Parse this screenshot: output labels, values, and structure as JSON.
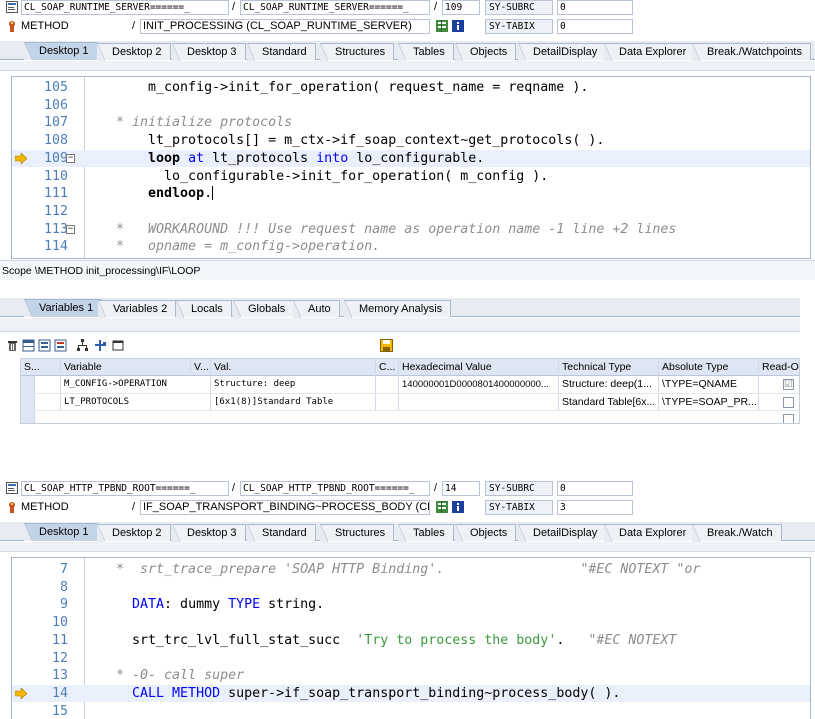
{
  "colors": {
    "tab_active": "#c4d4e8",
    "line_number": "#4f7eb7",
    "keyword": "#0000ff",
    "comment": "#8d8d8d",
    "string": "#3c9a3c",
    "arrow": "#f5b800"
  },
  "panel1": {
    "program": "CL_SOAP_RUNTIME_SERVER======_",
    "include": "CL_SOAP_RUNTIME_SERVER======_",
    "line": "109",
    "sy_subrc_label": "SY-SUBRC",
    "sy_subrc_value": "0",
    "event_type": "METHOD",
    "event_name": "INIT_PROCESSING (CL_SOAP_RUNTIME_SERVER)",
    "sy_tabix_label": "SY-TABIX",
    "sy_tabix_value": "0",
    "tabs": [
      "Desktop 1",
      "Desktop 2",
      "Desktop 3",
      "Standard",
      "Structures",
      "Tables",
      "Objects",
      "DetailDisplay",
      "Data Explorer",
      "Break./Watchpoints"
    ],
    "code": [
      {
        "ln": "105",
        "parts": [
          {
            "c": "",
            "t": "      m_config->init_for_operation( request_name = reqname )."
          }
        ]
      },
      {
        "ln": "106",
        "parts": []
      },
      {
        "ln": "107",
        "parts": [
          {
            "c": "cm",
            "t": "  * initialize protocols"
          }
        ]
      },
      {
        "ln": "108",
        "parts": [
          {
            "c": "",
            "t": "      lt_protocols[] = m_ctx->if_soap_context~get_protocols( )."
          }
        ]
      },
      {
        "ln": "109",
        "parts": [
          {
            "c": "kwb",
            "t": "      loop "
          },
          {
            "c": "kw",
            "t": "at "
          },
          {
            "c": "",
            "t": "lt_protocols "
          },
          {
            "c": "kw",
            "t": "into "
          },
          {
            "c": "",
            "t": "lo_configurable."
          }
        ]
      },
      {
        "ln": "110",
        "parts": [
          {
            "c": "",
            "t": "        lo_configurable->init_for_operation( m_config )."
          }
        ]
      },
      {
        "ln": "111",
        "parts": [
          {
            "c": "kwb",
            "t": "      endloop"
          },
          {
            "c": "",
            "t": "."
          }
        ]
      },
      {
        "ln": "112",
        "parts": []
      },
      {
        "ln": "113",
        "parts": [
          {
            "c": "cm",
            "t": "  *   WORKAROUND !!! Use request name as operation name -1 line +2 lines"
          }
        ]
      },
      {
        "ln": "114",
        "parts": [
          {
            "c": "cm",
            "t": "  *   opname = m_config->operation."
          }
        ]
      }
    ],
    "scope": "Scope \\METHOD init_processing\\IF\\LOOP",
    "var_tabs": [
      "Variables 1",
      "Variables 2",
      "Locals",
      "Globals",
      "Auto",
      "Memory Analysis"
    ],
    "grid_headers": [
      "S...",
      "Variable",
      "V...",
      "Val.",
      "C...",
      "Hexadecimal Value",
      "Technical Type",
      "Absolute Type",
      "Read-Only"
    ],
    "grid_rows": [
      {
        "variable": "M_CONFIG->OPERATION",
        "value": "Structure: deep",
        "hex": "140000001D0000801400000000...",
        "tech": "Structure: deep(1...",
        "abs": "\\TYPE=QNAME",
        "ro": "☑"
      },
      {
        "variable": "LT_PROTOCOLS",
        "value": "[6x1(8)]Standard Table",
        "hex": "",
        "tech": "Standard Table[6x...",
        "abs": "\\TYPE=SOAP_PR...",
        "ro": ""
      }
    ]
  },
  "panel2": {
    "program": "CL_SOAP_HTTP_TPBND_ROOT======_",
    "include": "CL_SOAP_HTTP_TPBND_ROOT======_",
    "line": "14",
    "sy_subrc_label": "SY-SUBRC",
    "sy_subrc_value": "0",
    "event_type": "METHOD",
    "event_name": "IF_SOAP_TRANSPORT_BINDING~PROCESS_BODY (CL...",
    "sy_tabix_label": "SY-TABIX",
    "sy_tabix_value": "3",
    "tabs": [
      "Desktop 1",
      "Desktop 2",
      "Desktop 3",
      "Standard",
      "Structures",
      "Tables",
      "Objects",
      "DetailDisplay",
      "Data Explorer",
      "Break./Watch"
    ],
    "code": [
      {
        "ln": "7",
        "parts": [
          {
            "c": "cm",
            "t": "  *  srt_trace_prepare 'SOAP HTTP Binding'.                 \"#EC NOTEXT \"or"
          }
        ]
      },
      {
        "ln": "8",
        "parts": []
      },
      {
        "ln": "9",
        "parts": [
          {
            "c": "kw",
            "t": "    DATA"
          },
          {
            "c": "",
            "t": ": dummy "
          },
          {
            "c": "kw",
            "t": "TYPE "
          },
          {
            "c": "",
            "t": "string."
          }
        ]
      },
      {
        "ln": "10",
        "parts": []
      },
      {
        "ln": "11",
        "parts": [
          {
            "c": "",
            "t": "    srt_trc_lvl_full_stat_succ  "
          },
          {
            "c": "str",
            "t": "'Try to process the body'"
          },
          {
            "c": "",
            "t": ".   "
          },
          {
            "c": "cm",
            "t": "\"#EC NOTEXT"
          }
        ]
      },
      {
        "ln": "12",
        "parts": []
      },
      {
        "ln": "13",
        "parts": [
          {
            "c": "cm",
            "t": "  * -0- call super"
          }
        ]
      },
      {
        "ln": "14",
        "parts": [
          {
            "c": "kw",
            "t": "    CALL METHOD "
          },
          {
            "c": "",
            "t": "super->if_soap_transport_binding~process_body( )."
          }
        ]
      },
      {
        "ln": "15",
        "parts": []
      }
    ]
  }
}
